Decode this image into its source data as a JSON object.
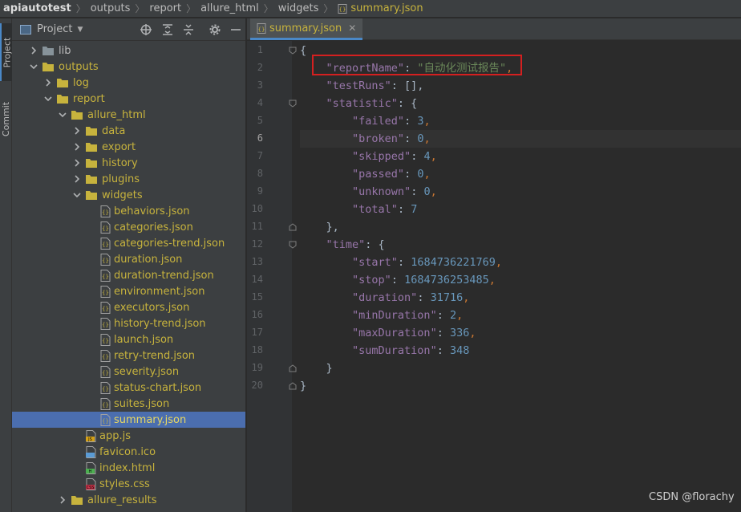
{
  "breadcrumb": {
    "items": [
      "apiautotest",
      "outputs",
      "report",
      "allure_html",
      "widgets"
    ],
    "file": "summary.json"
  },
  "toolstrip": {
    "project_tab": "Project",
    "commit_tab": "Commit"
  },
  "project_panel": {
    "title": "Project"
  },
  "tree": [
    {
      "label": "lib",
      "type": "folder",
      "depth": 1,
      "expanded": false
    },
    {
      "label": "outputs",
      "type": "folder",
      "depth": 1,
      "expanded": true
    },
    {
      "label": "log",
      "type": "folder",
      "depth": 2,
      "expanded": false
    },
    {
      "label": "report",
      "type": "folder",
      "depth": 2,
      "expanded": true
    },
    {
      "label": "allure_html",
      "type": "folder",
      "depth": 3,
      "expanded": true
    },
    {
      "label": "data",
      "type": "folder",
      "depth": 4,
      "expanded": false
    },
    {
      "label": "export",
      "type": "folder",
      "depth": 4,
      "expanded": false
    },
    {
      "label": "history",
      "type": "folder",
      "depth": 4,
      "expanded": false
    },
    {
      "label": "plugins",
      "type": "folder",
      "depth": 4,
      "expanded": false
    },
    {
      "label": "widgets",
      "type": "folder",
      "depth": 4,
      "expanded": true
    },
    {
      "label": "behaviors.json",
      "type": "json",
      "depth": 5
    },
    {
      "label": "categories.json",
      "type": "json",
      "depth": 5
    },
    {
      "label": "categories-trend.json",
      "type": "json",
      "depth": 5
    },
    {
      "label": "duration.json",
      "type": "json",
      "depth": 5
    },
    {
      "label": "duration-trend.json",
      "type": "json",
      "depth": 5
    },
    {
      "label": "environment.json",
      "type": "json",
      "depth": 5
    },
    {
      "label": "executors.json",
      "type": "json",
      "depth": 5
    },
    {
      "label": "history-trend.json",
      "type": "json",
      "depth": 5
    },
    {
      "label": "launch.json",
      "type": "json",
      "depth": 5
    },
    {
      "label": "retry-trend.json",
      "type": "json",
      "depth": 5
    },
    {
      "label": "severity.json",
      "type": "json",
      "depth": 5
    },
    {
      "label": "status-chart.json",
      "type": "json",
      "depth": 5
    },
    {
      "label": "suites.json",
      "type": "json",
      "depth": 5
    },
    {
      "label": "summary.json",
      "type": "json",
      "depth": 5,
      "selected": true
    },
    {
      "label": "app.js",
      "type": "js",
      "depth": 4
    },
    {
      "label": "favicon.ico",
      "type": "ico",
      "depth": 4
    },
    {
      "label": "index.html",
      "type": "html",
      "depth": 4
    },
    {
      "label": "styles.css",
      "type": "css",
      "depth": 4
    },
    {
      "label": "allure_results",
      "type": "folder",
      "depth": 3,
      "expanded": false
    }
  ],
  "editor": {
    "tab_label": "summary.json",
    "current_line": 6,
    "lines": [
      [
        {
          "t": "{",
          "c": "b"
        }
      ],
      [
        {
          "t": "    ",
          "c": "b"
        },
        {
          "t": "\"reportName\"",
          "c": "k"
        },
        {
          "t": ": ",
          "c": "b"
        },
        {
          "t": "\"自动化测试报告\"",
          "c": "s"
        },
        {
          "t": ",",
          "c": "p"
        }
      ],
      [
        {
          "t": "    ",
          "c": "b"
        },
        {
          "t": "\"testRuns\"",
          "c": "k"
        },
        {
          "t": ": [],",
          "c": "b"
        }
      ],
      [
        {
          "t": "    ",
          "c": "b"
        },
        {
          "t": "\"statistic\"",
          "c": "k"
        },
        {
          "t": ": {",
          "c": "b"
        }
      ],
      [
        {
          "t": "        ",
          "c": "b"
        },
        {
          "t": "\"failed\"",
          "c": "k"
        },
        {
          "t": ": ",
          "c": "b"
        },
        {
          "t": "3",
          "c": "n"
        },
        {
          "t": ",",
          "c": "p"
        }
      ],
      [
        {
          "t": "        ",
          "c": "b"
        },
        {
          "t": "\"broken\"",
          "c": "k"
        },
        {
          "t": ": ",
          "c": "b"
        },
        {
          "t": "0",
          "c": "n"
        },
        {
          "t": ",",
          "c": "p"
        }
      ],
      [
        {
          "t": "        ",
          "c": "b"
        },
        {
          "t": "\"skipped\"",
          "c": "k"
        },
        {
          "t": ": ",
          "c": "b"
        },
        {
          "t": "4",
          "c": "n"
        },
        {
          "t": ",",
          "c": "p"
        }
      ],
      [
        {
          "t": "        ",
          "c": "b"
        },
        {
          "t": "\"passed\"",
          "c": "k"
        },
        {
          "t": ": ",
          "c": "b"
        },
        {
          "t": "0",
          "c": "n"
        },
        {
          "t": ",",
          "c": "p"
        }
      ],
      [
        {
          "t": "        ",
          "c": "b"
        },
        {
          "t": "\"unknown\"",
          "c": "k"
        },
        {
          "t": ": ",
          "c": "b"
        },
        {
          "t": "0",
          "c": "n"
        },
        {
          "t": ",",
          "c": "p"
        }
      ],
      [
        {
          "t": "        ",
          "c": "b"
        },
        {
          "t": "\"total\"",
          "c": "k"
        },
        {
          "t": ": ",
          "c": "b"
        },
        {
          "t": "7",
          "c": "n"
        }
      ],
      [
        {
          "t": "    },",
          "c": "b"
        }
      ],
      [
        {
          "t": "    ",
          "c": "b"
        },
        {
          "t": "\"time\"",
          "c": "k"
        },
        {
          "t": ": {",
          "c": "b"
        }
      ],
      [
        {
          "t": "        ",
          "c": "b"
        },
        {
          "t": "\"start\"",
          "c": "k"
        },
        {
          "t": ": ",
          "c": "b"
        },
        {
          "t": "1684736221769",
          "c": "n"
        },
        {
          "t": ",",
          "c": "p"
        }
      ],
      [
        {
          "t": "        ",
          "c": "b"
        },
        {
          "t": "\"stop\"",
          "c": "k"
        },
        {
          "t": ": ",
          "c": "b"
        },
        {
          "t": "1684736253485",
          "c": "n"
        },
        {
          "t": ",",
          "c": "p"
        }
      ],
      [
        {
          "t": "        ",
          "c": "b"
        },
        {
          "t": "\"duration\"",
          "c": "k"
        },
        {
          "t": ": ",
          "c": "b"
        },
        {
          "t": "31716",
          "c": "n"
        },
        {
          "t": ",",
          "c": "p"
        }
      ],
      [
        {
          "t": "        ",
          "c": "b"
        },
        {
          "t": "\"minDuration\"",
          "c": "k"
        },
        {
          "t": ": ",
          "c": "b"
        },
        {
          "t": "2",
          "c": "n"
        },
        {
          "t": ",",
          "c": "p"
        }
      ],
      [
        {
          "t": "        ",
          "c": "b"
        },
        {
          "t": "\"maxDuration\"",
          "c": "k"
        },
        {
          "t": ": ",
          "c": "b"
        },
        {
          "t": "336",
          "c": "n"
        },
        {
          "t": ",",
          "c": "p"
        }
      ],
      [
        {
          "t": "        ",
          "c": "b"
        },
        {
          "t": "\"sumDuration\"",
          "c": "k"
        },
        {
          "t": ": ",
          "c": "b"
        },
        {
          "t": "348",
          "c": "n"
        }
      ],
      [
        {
          "t": "    }",
          "c": "b"
        }
      ],
      [
        {
          "t": "}",
          "c": "b"
        }
      ]
    ]
  },
  "watermark": "CSDN @florachy",
  "colors": {
    "folder": "#87939a",
    "excluded_folder": "#c7b33d",
    "selection": "#4b6eaf",
    "json_key": "#9876aa",
    "string": "#6a8759",
    "number": "#6897bb",
    "highlight_box": "#d42020"
  }
}
